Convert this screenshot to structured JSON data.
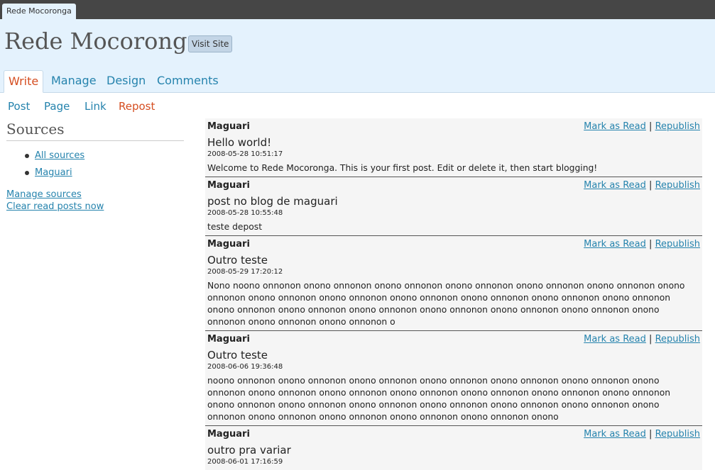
{
  "topbar": {
    "tab_label": "Rede Mocoronga"
  },
  "header": {
    "site_title": "Rede Mocoronga",
    "visit_site_label": "Visit Site"
  },
  "menu": {
    "items": [
      {
        "label": "Write"
      },
      {
        "label": "Manage"
      },
      {
        "label": "Design"
      },
      {
        "label": "Comments"
      }
    ]
  },
  "submenu": {
    "items": [
      {
        "label": "Post"
      },
      {
        "label": "Page"
      },
      {
        "label": "Link"
      },
      {
        "label": "Repost"
      }
    ]
  },
  "sidebar": {
    "title": "Sources",
    "sources": [
      {
        "label": "All sources"
      },
      {
        "label": "Maguari"
      }
    ],
    "manage_label": "Manage sources",
    "clear_label": "Clear read posts now"
  },
  "feed": {
    "mark_read_label": "Mark as Read",
    "separator": "|",
    "republish_label": "Republish",
    "posts": [
      {
        "author": "Maguari",
        "title": "Hello world!",
        "date": "2008-05-28 10:51:17",
        "body": "Welcome to Rede Mocoronga. This is your first post. Edit or delete it, then start blogging!"
      },
      {
        "author": "Maguari",
        "title": "post no blog de maguari",
        "date": "2008-05-28 10:55:48",
        "body": "teste depost"
      },
      {
        "author": "Maguari",
        "title": "Outro teste",
        "date": "2008-05-29 17:20:12",
        "body": "Nono noono onnonon onono onnonon onono onnonon onono onnonon onono onnonon onono onnonon onono onnonon onono onnonon onono onnonon onono onnonon onono onnonon onono onnonon onono onnonon onono onnonon onono onnonon onono onnonon onono onnonon onono onnonon onono onnonon onono onnonon onono onnonon onono onnonon o"
      },
      {
        "author": "Maguari",
        "title": "Outro teste",
        "date": "2008-06-06 19:36:48",
        "body": "noono onnonon onono onnonon onono onnonon onono onnonon onono onnonon onono onnonon onono onnonon onono onnonon onono onnonon onono onnonon onono onnonon onono onnonon onono onnonon onono onnonon onono onnonon onono onnonon onono onnonon onono onnonon onono onnonon onono onnonon onono onnonon onono onnonon onono onnonon onono onnonon onono"
      },
      {
        "author": "Maguari",
        "title": "outro pra variar",
        "date": "2008-06-01 17:16:59",
        "body": ""
      }
    ]
  }
}
